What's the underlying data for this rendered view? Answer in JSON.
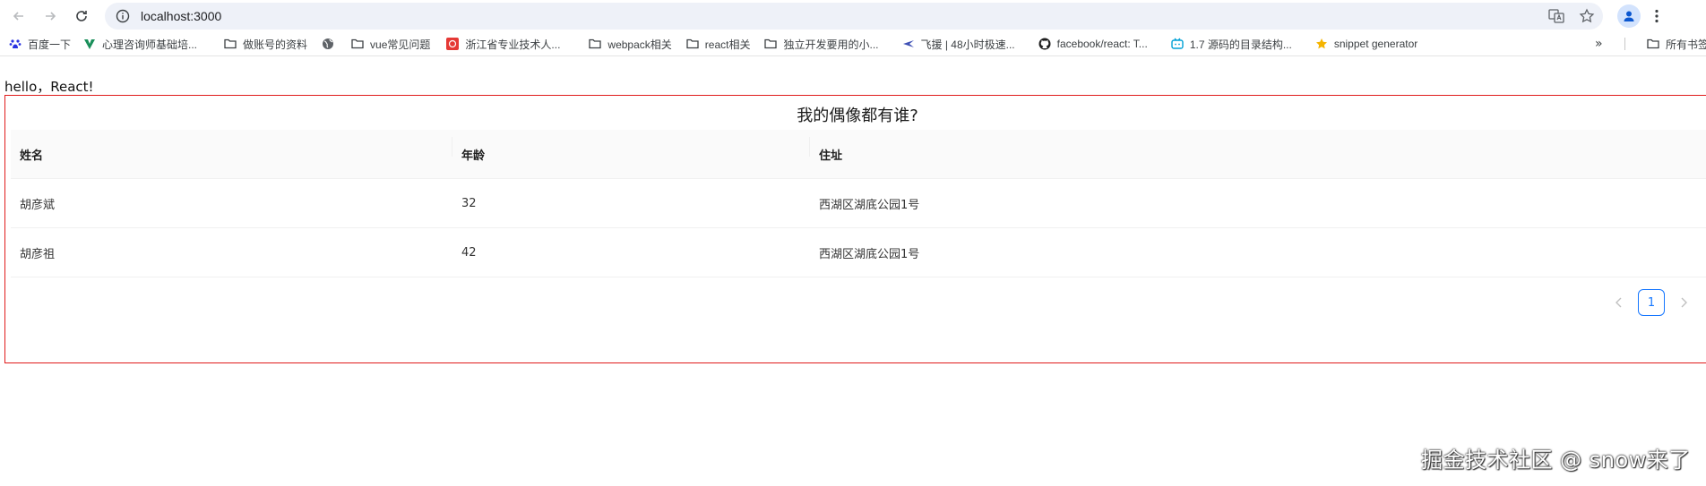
{
  "browser": {
    "url": "localhost:3000",
    "bookmarks": [
      {
        "label": "百度一下",
        "icon": "paw-icon"
      },
      {
        "label": "心理咨询师基础培...",
        "icon": "v-logo-icon"
      },
      {
        "label": "做账号的资料",
        "icon": "folder-icon"
      },
      {
        "label": "",
        "icon": "globe-icon"
      },
      {
        "label": "vue常见问题",
        "icon": "folder-icon"
      },
      {
        "label": "浙江省专业技术人...",
        "icon": "seal-icon"
      },
      {
        "label": "webpack相关",
        "icon": "folder-icon"
      },
      {
        "label": "react相关",
        "icon": "folder-icon"
      },
      {
        "label": "独立开发要用的小...",
        "icon": "folder-icon"
      },
      {
        "label": "飞援 | 48小时极速...",
        "icon": "plane-icon"
      },
      {
        "label": "facebook/react: T...",
        "icon": "github-icon"
      },
      {
        "label": "1.7 源码的目录结构...",
        "icon": "bilibili-icon"
      },
      {
        "label": "snippet generator",
        "icon": "star-badge-icon"
      }
    ],
    "more_label": "»",
    "all_bookmarks_label": "所有书签"
  },
  "page": {
    "hello": "hello，React!",
    "table_title": "我的偶像都有谁?",
    "columns": [
      "姓名",
      "年龄",
      "住址"
    ],
    "rows": [
      [
        "胡彦斌",
        "32",
        "西湖区湖底公园1号"
      ],
      [
        "胡彦祖",
        "42",
        "西湖区湖底公园1号"
      ]
    ],
    "pagination": {
      "current": "1"
    }
  },
  "watermark": "掘金技术社区 @ snow来了",
  "colors": {
    "frame_border": "#e01b1b",
    "accent": "#1677ff",
    "header_bg": "#fafafa"
  }
}
